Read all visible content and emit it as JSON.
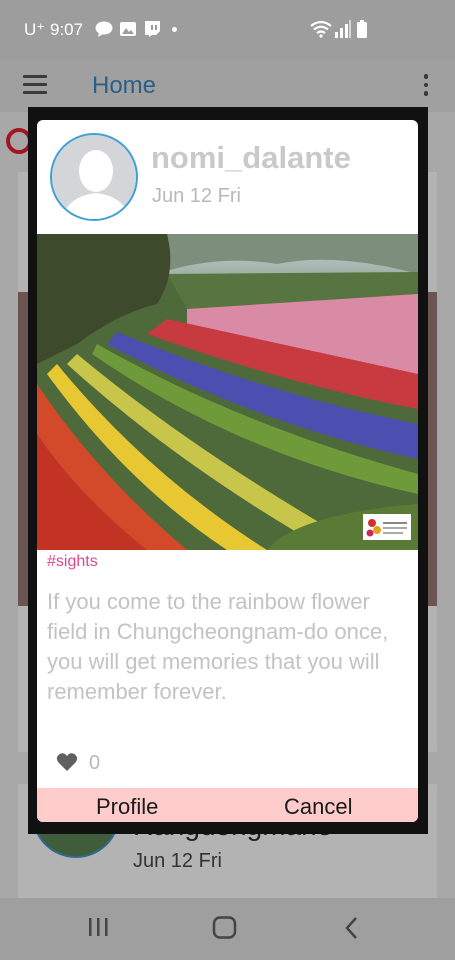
{
  "status_bar": {
    "carrier": "U⁺",
    "time": "9:07"
  },
  "app_bar": {
    "title": "Home"
  },
  "background": {
    "date": "Jun 12 Fri",
    "title_partial": "Rangdongmane"
  },
  "dialog": {
    "username": "nomi_dalante",
    "date": "Jun 12 Fri",
    "hashtag": "#sights",
    "text": "If you come to the rainbow flower field in Chungcheongnam-do once, you will get memories that you will remember forever.",
    "like_count": "0",
    "profile_button": "Profile",
    "cancel_button": "Cancel"
  },
  "colors": {
    "accent": "#3da1d6",
    "hashtag": "#d94a8c",
    "button_bar": "#ffcccc",
    "title": "#2a5f8a"
  }
}
